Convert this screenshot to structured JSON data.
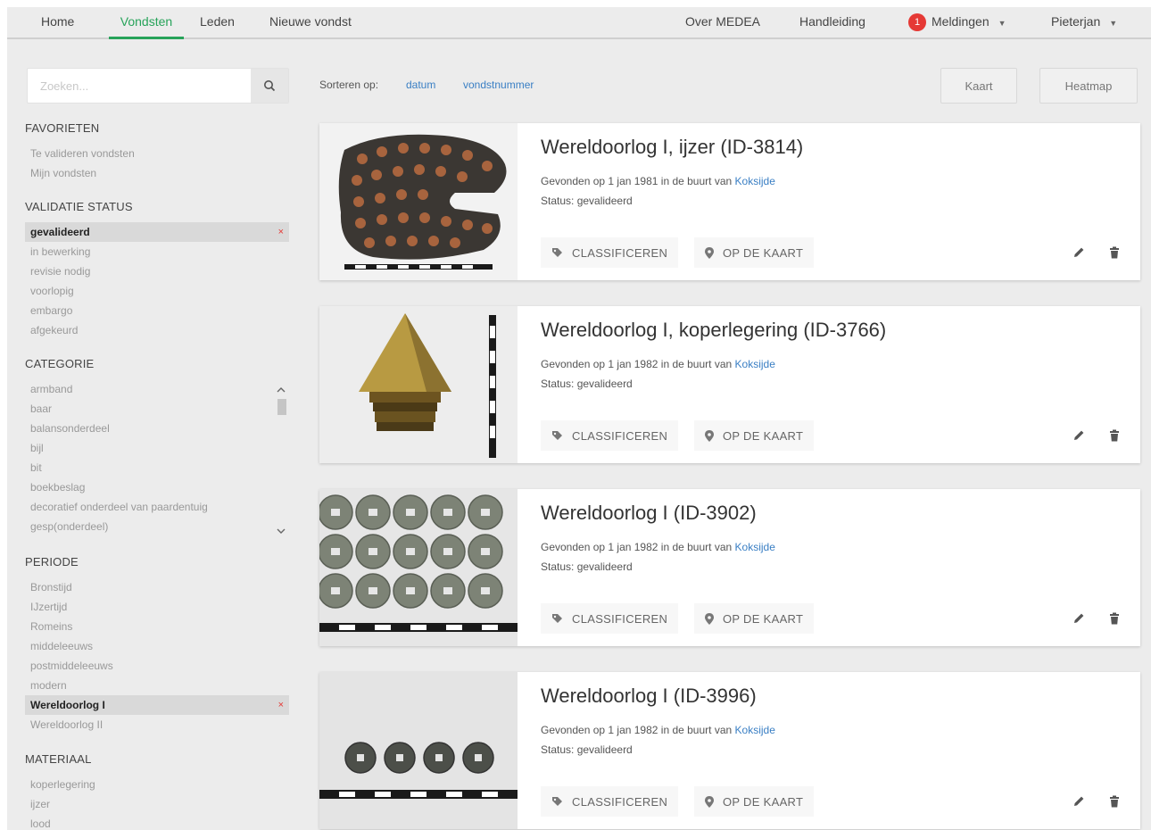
{
  "nav": {
    "home": "Home",
    "finds": "Vondsten",
    "members": "Leden",
    "new_find": "Nieuwe vondst",
    "about": "Over MEDEA",
    "manual": "Handleiding",
    "notifications_count": "1",
    "notifications": "Meldingen",
    "user": "Pieterjan",
    "caret": "▼"
  },
  "search": {
    "placeholder": "Zoeken..."
  },
  "sort": {
    "label": "Sorteren op:",
    "options": [
      "datum",
      "vondstnummer"
    ]
  },
  "toolbar": {
    "map": "Kaart",
    "heatmap": "Heatmap"
  },
  "facets": {
    "favorites": {
      "title": "FAVORIETEN",
      "items": [
        "Te valideren vondsten",
        "Mijn vondsten"
      ]
    },
    "validation": {
      "title": "VALIDATIE STATUS",
      "items": [
        "gevalideerd",
        "in bewerking",
        "revisie nodig",
        "voorlopig",
        "embargo",
        "afgekeurd"
      ],
      "selected": "gevalideerd",
      "clear": "×"
    },
    "category": {
      "title": "CATEGORIE",
      "items": [
        "armband",
        "baar",
        "balansonderdeel",
        "bijl",
        "bit",
        "boekbeslag",
        "decoratief onderdeel van paardentuig",
        "gesp(onderdeel)"
      ]
    },
    "period": {
      "title": "PERIODE",
      "items": [
        "Bronstijd",
        "IJzertijd",
        "Romeins",
        "middeleeuws",
        "postmiddeleeuws",
        "modern",
        "Wereldoorlog I",
        "Wereldoorlog II"
      ],
      "selected": "Wereldoorlog I",
      "clear": "×"
    },
    "material": {
      "title": "MATERIAAL",
      "items": [
        "koperlegering",
        "ijzer",
        "lood"
      ]
    }
  },
  "card_actions": {
    "classify": "CLASSIFICEREN",
    "map": "OP DE KAART"
  },
  "finds": [
    {
      "title": "Wereldoorlog I, ijzer (ID-3814)",
      "found_prefix": "Gevonden op 1 jan 1981 in de buurt van",
      "place": "Koksijde",
      "status": "Status: gevalideerd"
    },
    {
      "title": "Wereldoorlog I, koperlegering (ID-3766)",
      "found_prefix": "Gevonden op 1 jan 1982 in de buurt van",
      "place": "Koksijde",
      "status": "Status: gevalideerd"
    },
    {
      "title": "Wereldoorlog I (ID-3902)",
      "found_prefix": "Gevonden op 1 jan 1982 in de buurt van",
      "place": "Koksijde",
      "status": "Status: gevalideerd"
    },
    {
      "title": "Wereldoorlog I (ID-3996)",
      "found_prefix": "Gevonden op 1 jan 1982 in de buurt van",
      "place": "Koksijde",
      "status": "Status: gevalideerd"
    }
  ],
  "colors": {
    "accent": "#27a35a",
    "link": "#3a7fc4",
    "badge": "#e53935",
    "background": "#ececec"
  },
  "icons": [
    "search-icon",
    "tag-icon",
    "map-marker-icon",
    "pencil-icon",
    "trash-icon",
    "close-icon",
    "chevron-up-icon",
    "chevron-down-icon"
  ]
}
